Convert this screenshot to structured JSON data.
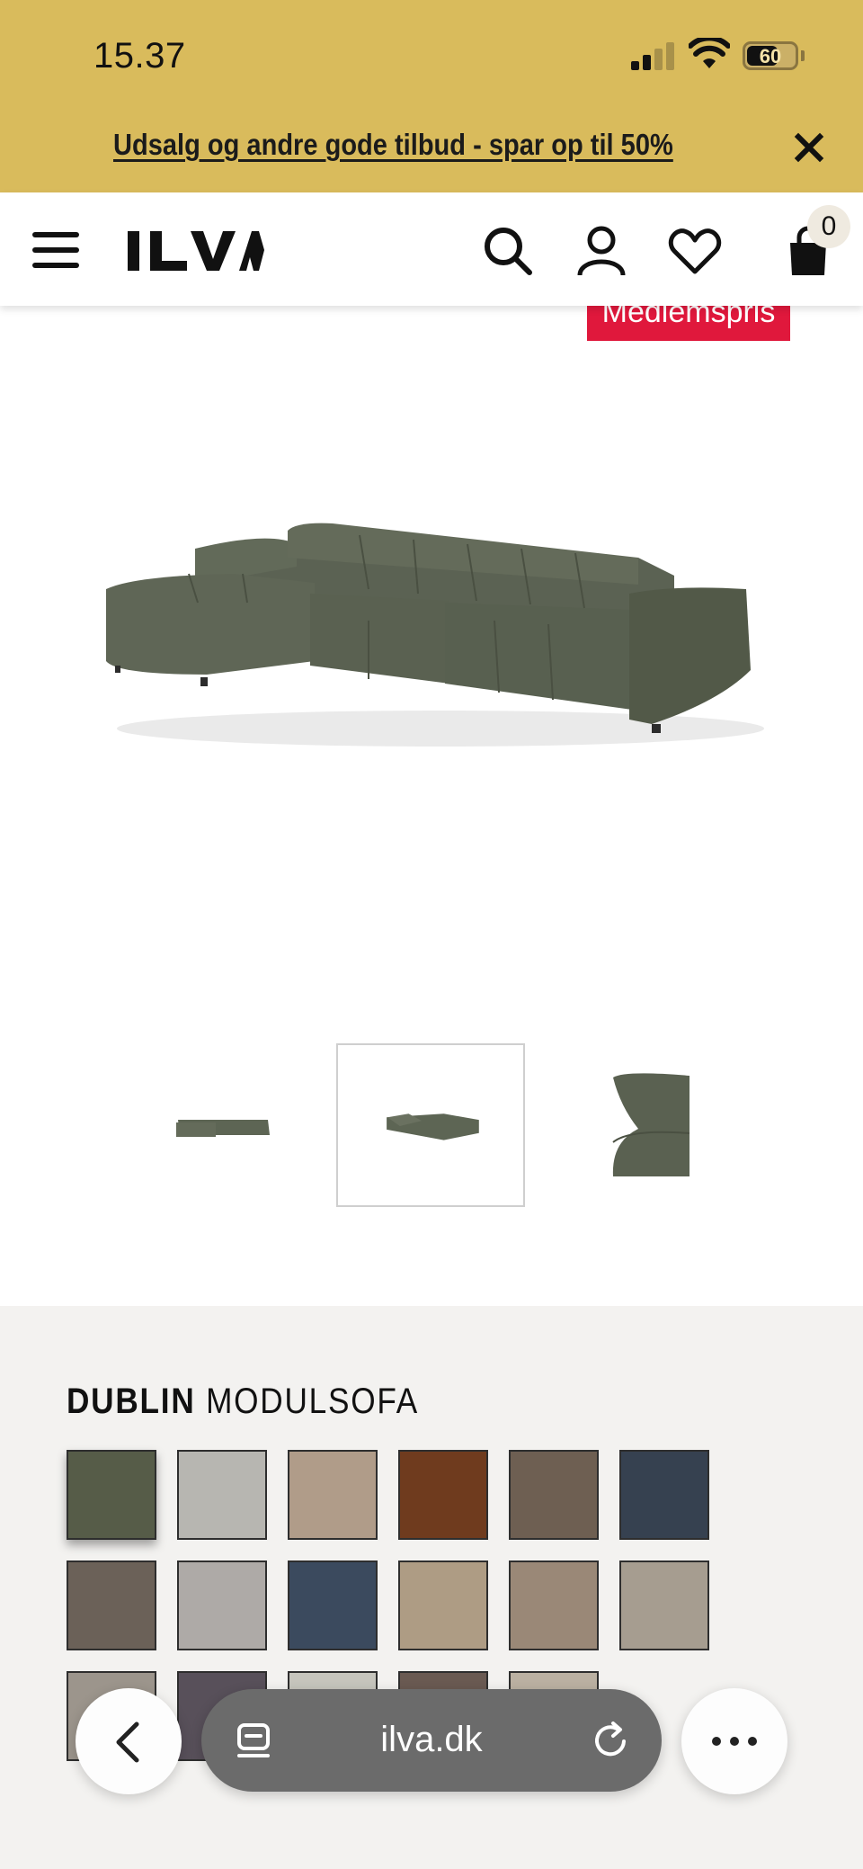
{
  "status_bar": {
    "time": "15.37",
    "battery": "60"
  },
  "promo": {
    "text": "Udsalg og andre gode tilbud - spar op til 50%"
  },
  "header": {
    "logo": "ILVA",
    "cart_count": "0"
  },
  "product": {
    "badge": "Medlemspris",
    "name_bold": "DUBLIN",
    "name_rest": "MODULSOFA",
    "main_color": "#5d6554"
  },
  "swatches": [
    "#565c48",
    "#b7b6b1",
    "#b09c89",
    "#6f3b1e",
    "#6e5f52",
    "#364150",
    "#6b6158",
    "#aeaaa7",
    "#3b4a5e",
    "#ae9c84",
    "#9a8877",
    "#a69d90",
    "#9c958c",
    "#58505a",
    "#c6c5bd",
    "#6a5a52",
    "#bbb1a2"
  ],
  "browser": {
    "url": "ilva.dk"
  }
}
